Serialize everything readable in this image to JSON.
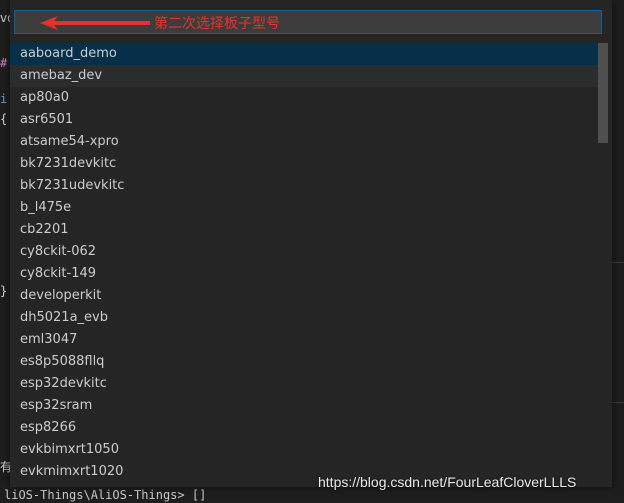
{
  "editor_fragments": {
    "tab_label": "vo",
    "line_chars": [
      "#",
      "i",
      "{",
      "}"
    ]
  },
  "quick_pick": {
    "input_value": "",
    "items": [
      "aaboard_demo",
      "amebaz_dev",
      "ap80a0",
      "asr6501",
      "atsame54-xpro",
      "bk7231devkitc",
      "bk7231udevkitc",
      "b_l475e",
      "cb2201",
      "cy8ckit-062",
      "cy8ckit-149",
      "developerkit",
      "dh5021a_evb",
      "eml3047",
      "es8p5088fllq",
      "esp32devkitc",
      "esp32sram",
      "esp8266",
      "evkbimxrt1050",
      "evkmimxrt1020"
    ],
    "focused_index": 0,
    "hover_index": 1
  },
  "annotation": {
    "text": "第二次选择板子型号",
    "color": "#e8312f"
  },
  "terminal": {
    "side_char": "有",
    "prompt": "liOS-Things\\AliOS-Things> []"
  },
  "watermark": "https://blog.csdn.net/FourLeafCloverLLLS"
}
